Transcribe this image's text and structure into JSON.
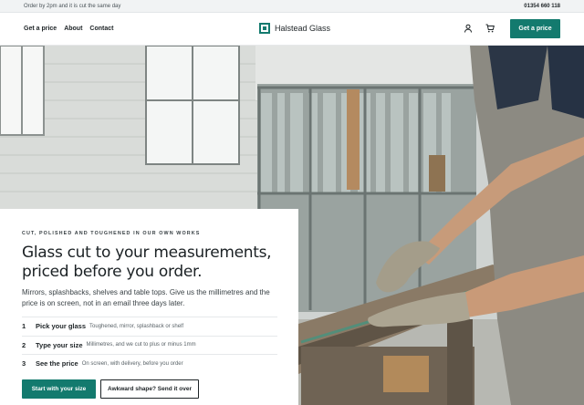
{
  "topbar": {
    "note": "Order by 2pm and it is cut the same day",
    "phone": "01354 660 118"
  },
  "nav": [
    {
      "label": "Get a price"
    },
    {
      "label": "About"
    },
    {
      "label": "Contact"
    }
  ],
  "brand": {
    "name": "Halstead Glass"
  },
  "header": {
    "cta": "Get a price"
  },
  "hero": {
    "eyebrow": "CUT, POLISHED AND TOUGHENED IN OUR OWN WORKS",
    "title_line1": "Glass cut to your measurements,",
    "title_line2": "priced before you order.",
    "lead": "Mirrors, splashbacks, shelves and table tops. Give us the millimetres and the price is on screen, not in an email three days later.",
    "steps": [
      {
        "num": "1",
        "title": "Pick your glass",
        "desc": "Toughened, mirror, splashback or shelf"
      },
      {
        "num": "2",
        "title": "Type your size",
        "desc": "Millimetres, and we cut to plus or minus 1mm"
      },
      {
        "num": "3",
        "title": "See the price",
        "desc": "On screen, with delivery, before you order"
      }
    ],
    "primary": "Start with your size",
    "secondary": "Awkward shape? Send it over"
  }
}
